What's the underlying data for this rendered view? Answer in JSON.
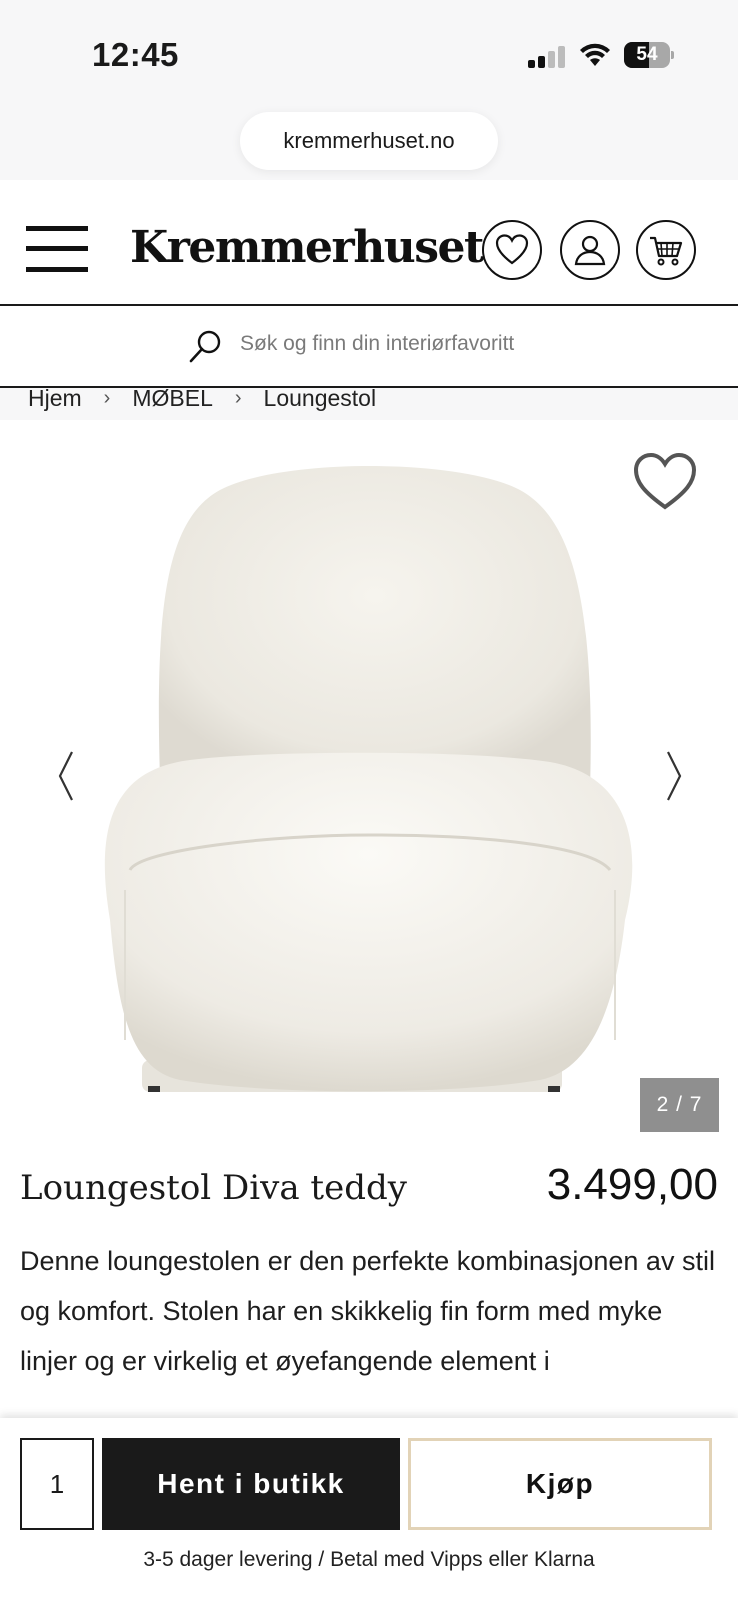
{
  "status_bar": {
    "time": "12:45",
    "battery_percent": "54",
    "battery_level": 0.54,
    "signal_bars_active": 2,
    "signal_bars_total": 4
  },
  "browser": {
    "url": "kremmerhuset.no"
  },
  "header": {
    "logo": "Kremmerhuset",
    "icons": [
      "menu-icon",
      "heart-icon",
      "user-icon",
      "cart-icon"
    ]
  },
  "search": {
    "placeholder": "Søk og finn din interiørfavoritt"
  },
  "breadcrumb": {
    "items": [
      "Hjem",
      "MØBEL",
      "Loungestol"
    ],
    "separator": "›"
  },
  "gallery": {
    "counter": "2 / 7"
  },
  "product": {
    "title": "Loungestol Diva teddy",
    "price": "3.499,00",
    "description": "Denne loungestolen er den perfekte kombinasjonen av stil og komfort. Stolen har en skikkelig fin form med myke linjer og er virkelig et øyefangende element i"
  },
  "actions": {
    "quantity": "1",
    "pickup_label": "Hent i butikk",
    "buy_label": "Kjøp",
    "delivery_note": "3-5 dager levering / Betal med Vipps eller Klarna"
  },
  "colors": {
    "text": "#1a1a1a",
    "buy_border": "#e2d3b7",
    "counter_bg": "#8f8f8f"
  }
}
